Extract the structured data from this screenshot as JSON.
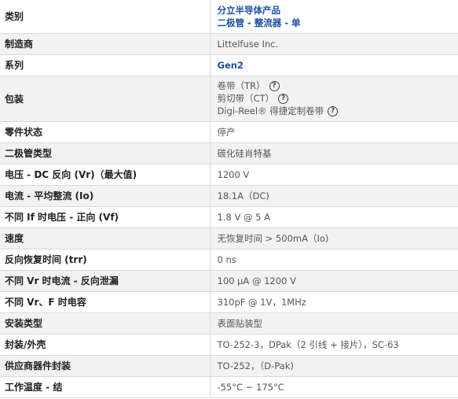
{
  "rows": [
    {
      "key": "类别",
      "lines": [
        "分立半导体产品",
        "二极管 - 整流器 - 单"
      ],
      "link": true
    },
    {
      "key": "制造商",
      "lines": [
        "Littelfuse Inc."
      ]
    },
    {
      "key": "系列",
      "lines": [
        "Gen2"
      ],
      "link": true
    },
    {
      "key": "包装",
      "lines": [
        "卷带（TR）",
        "剪切带（CT）",
        "Digi-Reel® 得捷定制卷带"
      ],
      "help_icon": "question-circle-icon"
    },
    {
      "key": "零件状态",
      "lines": [
        "停产"
      ]
    },
    {
      "key": "二极管类型",
      "lines": [
        "碳化硅肖特基"
      ]
    },
    {
      "key": "电压 - DC 反向 (Vr)（最大值)",
      "lines": [
        "1200 V"
      ]
    },
    {
      "key": "电流 - 平均整流 (Io)",
      "lines": [
        "18.1A（DC)"
      ]
    },
    {
      "key": "不同 If 时电压 - 正向 (Vf)",
      "lines": [
        "1.8 V @ 5 A"
      ]
    },
    {
      "key": "速度",
      "lines": [
        "无恢复时间 > 500mA（Io)"
      ]
    },
    {
      "key": "反向恢复时间 (trr)",
      "lines": [
        "0 ns"
      ]
    },
    {
      "key": "不同 Vr 时电流 - 反向泄漏",
      "lines": [
        "100 µA @ 1200 V"
      ]
    },
    {
      "key": "不同 Vr、F 时电容",
      "lines": [
        "310pF @ 1V，1MHz"
      ]
    },
    {
      "key": "安装类型",
      "lines": [
        "表面贴装型"
      ]
    },
    {
      "key": "封装/外壳",
      "lines": [
        "TO-252-3，DPak（2 引线 + 接片），SC-63"
      ]
    },
    {
      "key": "供应商器件封装",
      "lines": [
        "TO-252，（D-Pak)"
      ]
    },
    {
      "key": "工作温度 - 结",
      "lines": [
        "-55°C ~ 175°C"
      ]
    }
  ],
  "colors": {
    "link": "#1a4fa3",
    "row_alt": "#f2f2f2",
    "border": "#d9d9d9"
  }
}
